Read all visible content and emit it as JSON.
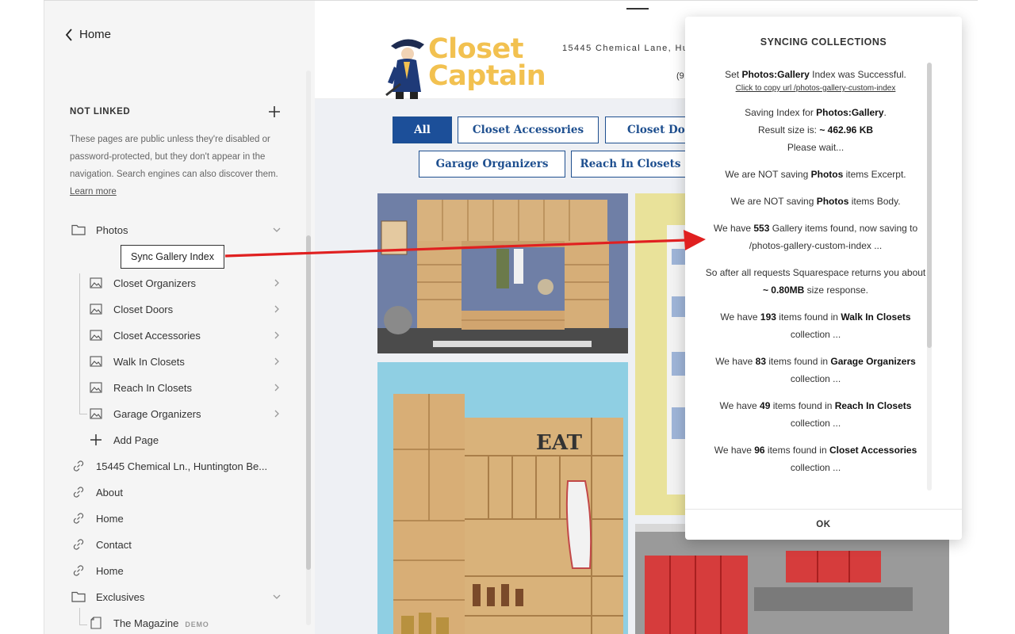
{
  "sidebar": {
    "home_label": "Home",
    "section_title": "NOT LINKED",
    "section_desc": "These pages are public unless they're disabled or password-protected, but they don't appear in the navigation. Search engines can also discover them.",
    "learn_more": "Learn more",
    "photos_label": "Photos",
    "sync_tooltip": "Sync Gallery Index",
    "galleries": [
      {
        "label": "Closet Organizers"
      },
      {
        "label": "Closet Doors"
      },
      {
        "label": "Closet Accessories"
      },
      {
        "label": "Walk In Closets"
      },
      {
        "label": "Reach In Closets"
      },
      {
        "label": "Garage Organizers"
      }
    ],
    "add_page": "Add Page",
    "links": [
      {
        "label": "15445 Chemical Ln., Huntington Be..."
      },
      {
        "label": "About"
      },
      {
        "label": "Home"
      },
      {
        "label": "Contact"
      },
      {
        "label": "Home"
      }
    ],
    "exclusives_label": "Exclusives",
    "magazine_label": "The Magazine",
    "demo_tag": "DEMO"
  },
  "preview": {
    "logo_line1": "Closet",
    "logo_line2": "Captain",
    "address": "15445 Chemical Lane, Hun",
    "phone": "(9",
    "filters": [
      {
        "label": "All",
        "active": true
      },
      {
        "label": "Closet Accessories"
      },
      {
        "label": "Closet Doo"
      },
      {
        "label": "Garage Organizers"
      },
      {
        "label": "Reach In Closets"
      }
    ]
  },
  "modal": {
    "title": "SYNCING COLLECTIONS",
    "ok_label": "OK",
    "copy_link": "Click to copy url /photos-gallery-custom-index",
    "m1_a": "Set ",
    "m1_b": "Photos:Gallery",
    "m1_c": " Index was Successful.",
    "m2_a": "Saving Index for ",
    "m2_b": "Photos:Gallery",
    "m2_c": ".",
    "m2_d": "Result size is: ",
    "m2_e": "~ 462.96 KB",
    "m2_f": "Please wait...",
    "m3_a": "We are NOT saving ",
    "m3_b": "Photos",
    "m3_c": " items Excerpt.",
    "m4_a": "We are NOT saving ",
    "m4_b": "Photos",
    "m4_c": " items Body.",
    "m5_a": "We have ",
    "m5_b": "553",
    "m5_c": " Gallery items found, now saving to /photos-gallery-custom-index ...",
    "m6_a": "So after all requests Squarespace returns you about ",
    "m6_b": "~ 0.80MB",
    "m6_c": " size response.",
    "m7_a": "We have ",
    "m7_b": "193",
    "m7_c": " items found in ",
    "m7_d": "Walk In Closets",
    "m7_e": " collection ...",
    "m8_a": "We have ",
    "m8_b": "83",
    "m8_c": " items found in ",
    "m8_d": "Garage Organizers",
    "m8_e": " collection ...",
    "m9_a": "We have ",
    "m9_b": "49",
    "m9_c": " items found in ",
    "m9_d": "Reach In Closets",
    "m9_e": " collection ...",
    "m10_a": "We have ",
    "m10_b": "96",
    "m10_c": " items found in ",
    "m10_d": "Closet Accessories",
    "m10_e": " collection ..."
  },
  "colors": {
    "accent_blue": "#1c4f99",
    "logo_yellow": "#f2c150",
    "arrow_red": "#e02020"
  }
}
